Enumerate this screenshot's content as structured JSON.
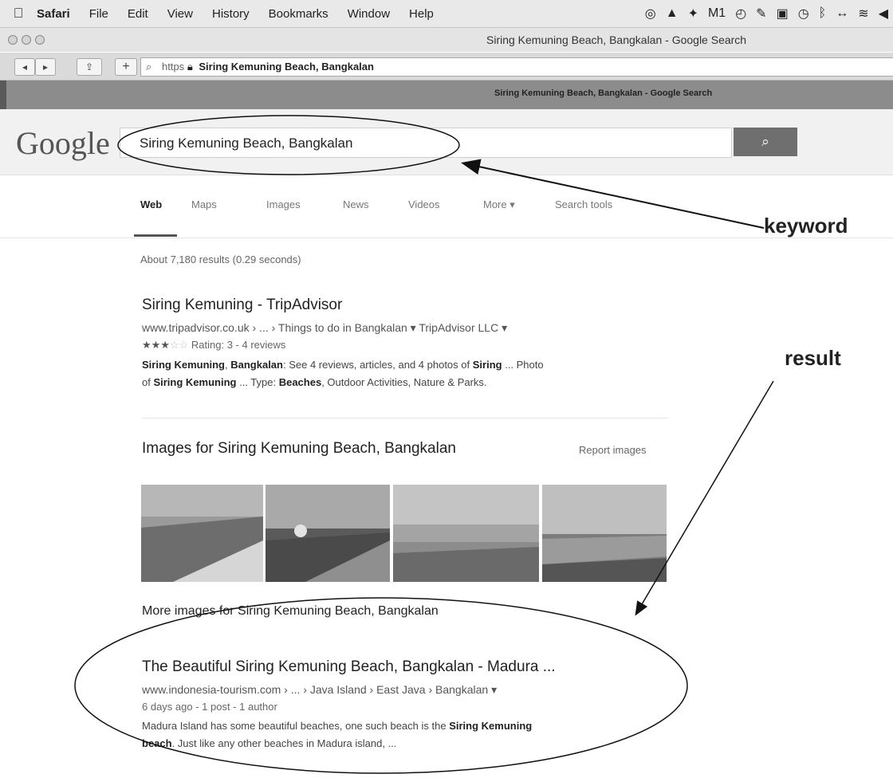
{
  "menubar": {
    "items": [
      "Safari",
      "File",
      "Edit",
      "View",
      "History",
      "Bookmarks",
      "Window",
      "Help"
    ],
    "tray_text": "M1"
  },
  "window": {
    "title": "Siring Kemuning Beach, Bangkalan - Google Search"
  },
  "toolbar": {
    "url_prefix": "https",
    "url_text": "Siring Kemuning Beach, Bangkalan"
  },
  "tab": {
    "title": "Siring Kemuning Beach, Bangkalan - Google Search"
  },
  "google": {
    "logo": "Google",
    "query": "Siring Kemuning Beach, Bangkalan",
    "nav": [
      "Web",
      "Maps",
      "Images",
      "News",
      "Videos",
      "More ▾",
      "Search tools"
    ],
    "stats": "About 7,180 results (0.29 seconds)"
  },
  "results": [
    {
      "title": "Siring Kemuning - TripAdvisor",
      "url": "www.tripadvisor.co.uk › ... › Things to do in Bangkalan ▾ TripAdvisor LLC ▾",
      "rating": "Rating: 3 - 4 reviews",
      "rating_value": 3,
      "rating_max": 5,
      "snippet_1": "Siring Kemuning, Bangkalan: See 4 reviews, articles, and 4 photos of Siring ... Photo",
      "snippet_2": "of Siring Kemuning ... Type: Beaches, Outdoor Activities, Nature & Parks."
    },
    {
      "title": "The Beautiful Siring Kemuning Beach, Bangkalan - Madura ...",
      "url": "www.indonesia-tourism.com › ... › Java Island › East Java › Bangkalan ▾",
      "meta": "6 days ago - 1 post - 1 author",
      "snippet_1": "Madura Island has some beautiful beaches, one such beach is the Siring Kemuning",
      "snippet_2": "beach. Just like any other beaches in Madura island, ..."
    }
  ],
  "images_block": {
    "heading": "Images for Siring Kemuning Beach, Bangkalan",
    "report": "Report images",
    "more": "More images for Siring Kemuning Beach, Bangkalan"
  },
  "annotations": {
    "keyword": "keyword",
    "result": "result"
  }
}
